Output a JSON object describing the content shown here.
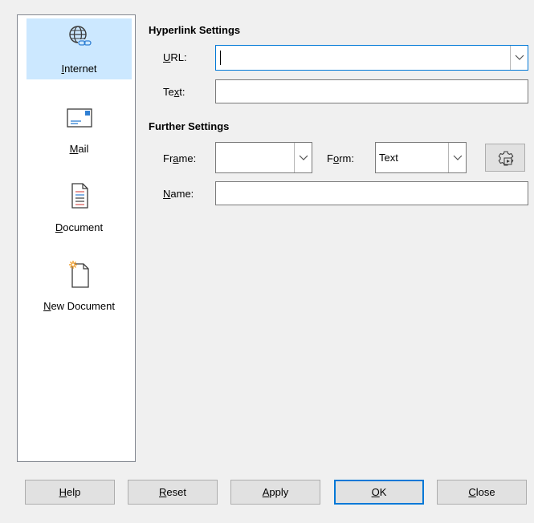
{
  "sidebar": {
    "items": [
      {
        "label": "Internet",
        "accel": "I",
        "rest": "nternet",
        "icon": "globe-link-icon",
        "selected": true
      },
      {
        "label": "Mail",
        "accel": "M",
        "rest": "ail",
        "icon": "envelope-icon",
        "selected": false
      },
      {
        "label": "Document",
        "accel": "D",
        "rest": "ocument",
        "icon": "document-icon",
        "selected": false
      },
      {
        "label": "New Document",
        "accel": "N",
        "rest": "ew Document",
        "icon": "new-document-icon",
        "selected": false
      }
    ]
  },
  "hyperlink_settings": {
    "title": "Hyperlink Settings",
    "url_label_accel": "U",
    "url_label_rest": "RL:",
    "url_value": "",
    "text_label_pre": "Te",
    "text_label_accel": "x",
    "text_label_post": "t:",
    "text_value": ""
  },
  "further_settings": {
    "title": "Further Settings",
    "frame_label_pre": "Fr",
    "frame_label_accel": "a",
    "frame_label_post": "me:",
    "frame_value": "",
    "form_label_pre": "F",
    "form_label_accel": "o",
    "form_label_post": "rm:",
    "form_value": "Text",
    "name_label_accel": "N",
    "name_label_rest": "ame:",
    "name_value": "",
    "events_icon": "events-gear-icon"
  },
  "buttons": {
    "help": {
      "accel": "H",
      "rest": "elp"
    },
    "reset": {
      "accel": "R",
      "rest": "eset"
    },
    "apply": {
      "accel": "A",
      "rest": "pply"
    },
    "ok": {
      "accel": "O",
      "rest": "K"
    },
    "close": {
      "accel": "C",
      "rest": "lose"
    }
  },
  "colors": {
    "selection": "#cce8ff",
    "accent": "#0078d7"
  }
}
